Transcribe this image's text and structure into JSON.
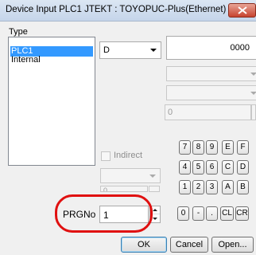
{
  "window": {
    "title": "Device Input  PLC1 JTEKT : TOYOPUC-Plus(Ethernet)"
  },
  "type_group": {
    "label": "Type",
    "items": [
      "PLC1",
      "Internal"
    ],
    "selected": "PLC1"
  },
  "device": {
    "selected": "D",
    "address": "0000"
  },
  "extra": {
    "spin_value": "0"
  },
  "indirect": {
    "label": "Indirect",
    "value": "0"
  },
  "prgno": {
    "label": "PRGNo",
    "value": "1"
  },
  "keypad": {
    "row1": [
      "7",
      "8",
      "9",
      "E",
      "F"
    ],
    "row2": [
      "4",
      "5",
      "6",
      "C",
      "D"
    ],
    "row3": [
      "1",
      "2",
      "3",
      "A",
      "B"
    ],
    "row4": [
      "0",
      "-",
      ".",
      "CL",
      "CR"
    ]
  },
  "buttons": {
    "ok": "OK",
    "cancel": "Cancel",
    "open": "Open..."
  },
  "colors": {
    "selection": "#3399ff",
    "highlight_ring": "#e01010",
    "close_button": "#c7432f"
  }
}
